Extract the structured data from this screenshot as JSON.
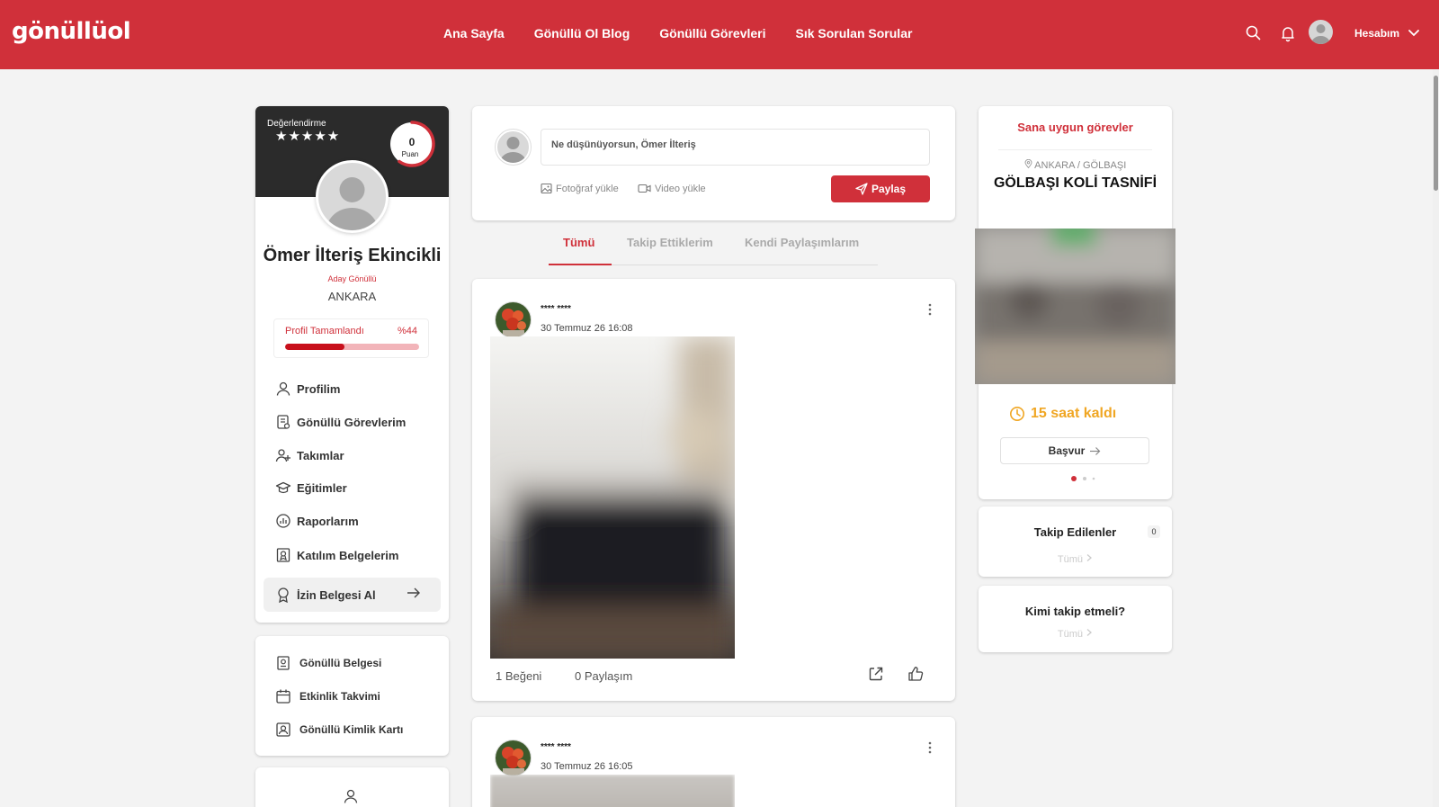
{
  "header": {
    "logo": "gönüllüol",
    "nav": [
      "Ana Sayfa",
      "Gönüllü Ol Blog",
      "Gönüllü Görevleri",
      "Sık Sorulan Sorular"
    ],
    "account_label": "Hesabım"
  },
  "profile": {
    "rating_label": "Değerlendirme",
    "stars": "★★★★★",
    "points_value": "0",
    "points_label": "Puan",
    "name": "Ömer İlteriş Ekincikli",
    "role": "Aday Gönüllü",
    "city": "ANKARA",
    "completion_label": "Profil Tamamlandı",
    "completion_text": "%44",
    "completion_fraction": 0.44,
    "menu": [
      {
        "label": "Profilim",
        "icon": "user-icon"
      },
      {
        "label": "Gönüllü Görevlerim",
        "icon": "tasks-icon"
      },
      {
        "label": "Takımlar",
        "icon": "team-icon"
      },
      {
        "label": "Eğitimler",
        "icon": "graduation-icon"
      },
      {
        "label": "Raporlarım",
        "icon": "report-icon"
      },
      {
        "label": "Katılım Belgelerim",
        "icon": "certificate-icon"
      },
      {
        "label": "İzin Belgesi Al",
        "icon": "badge-icon"
      }
    ]
  },
  "secondary_menu": [
    {
      "label": "Gönüllü Belgesi",
      "icon": "document-icon"
    },
    {
      "label": "Etkinlik Takvimi",
      "icon": "calendar-icon"
    },
    {
      "label": "Gönüllü Kimlik Kartı",
      "icon": "id-card-icon"
    }
  ],
  "composer": {
    "placeholder": "Ne düşünüyorsun, Ömer İlteriş",
    "photo_label": "Fotoğraf yükle",
    "video_label": "Video yükle",
    "share_label": "Paylaş"
  },
  "feed_tabs": [
    {
      "label": "Tümü",
      "active": true
    },
    {
      "label": "Takip Ettiklerim",
      "active": false
    },
    {
      "label": "Kendi Paylaşımlarım",
      "active": false
    }
  ],
  "posts": [
    {
      "author": "**** ****",
      "date": "30 Temmuz 26 16:08",
      "likes": "1 Beğeni",
      "shares": "0 Paylaşım"
    },
    {
      "author": "**** ****",
      "date": "30 Temmuz 26 16:05"
    }
  ],
  "suggested": {
    "title": "Sana uygun görevler",
    "location": "ANKARA / GÖLBAŞI",
    "task": "GÖLBAŞI KOLİ TASNİFİ",
    "time_left": "15 saat kaldı",
    "apply_label": "Başvur"
  },
  "following": {
    "title": "Takip Edilenler",
    "count": "0",
    "all_label": "Tümü"
  },
  "who_to_follow": {
    "title": "Kimi takip etmeli?",
    "all_label": "Tümü"
  },
  "colors": {
    "brand": "#d0303a",
    "dark": "#2b2b2b",
    "warning": "#f0a623"
  }
}
